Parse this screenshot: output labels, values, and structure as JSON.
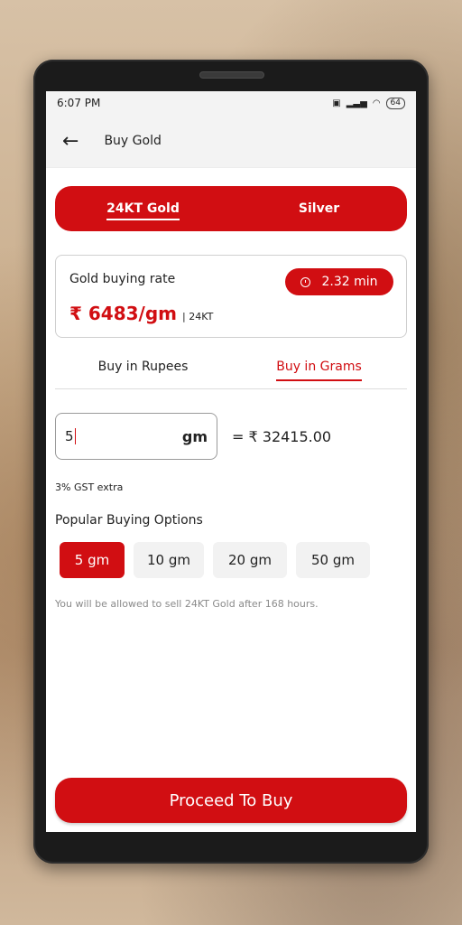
{
  "status": {
    "time": "6:07 PM",
    "battery": "64"
  },
  "header": {
    "title": "Buy Gold"
  },
  "metals": {
    "tabs": [
      "24KT Gold",
      "Silver"
    ],
    "active": "24KT Gold"
  },
  "rate": {
    "label": "Gold buying rate",
    "value": "₹ 6483/gm",
    "unit": "| 24KT",
    "timer": "2.32 min"
  },
  "modes": {
    "tabs": [
      "Buy in Rupees",
      "Buy in Grams"
    ],
    "active": "Buy in Grams"
  },
  "input": {
    "value": "5",
    "unit": "gm",
    "equals": "= ₹ 32415.00"
  },
  "gst_note": "3% GST extra",
  "popular": {
    "title": "Popular Buying Options",
    "options": [
      "5 gm",
      "10 gm",
      "20 gm",
      "50 gm"
    ],
    "selected": "5 gm"
  },
  "note": "You will be allowed to sell 24KT Gold after 168 hours.",
  "proceed_label": "Proceed To Buy",
  "colors": {
    "accent": "#d10e12"
  }
}
